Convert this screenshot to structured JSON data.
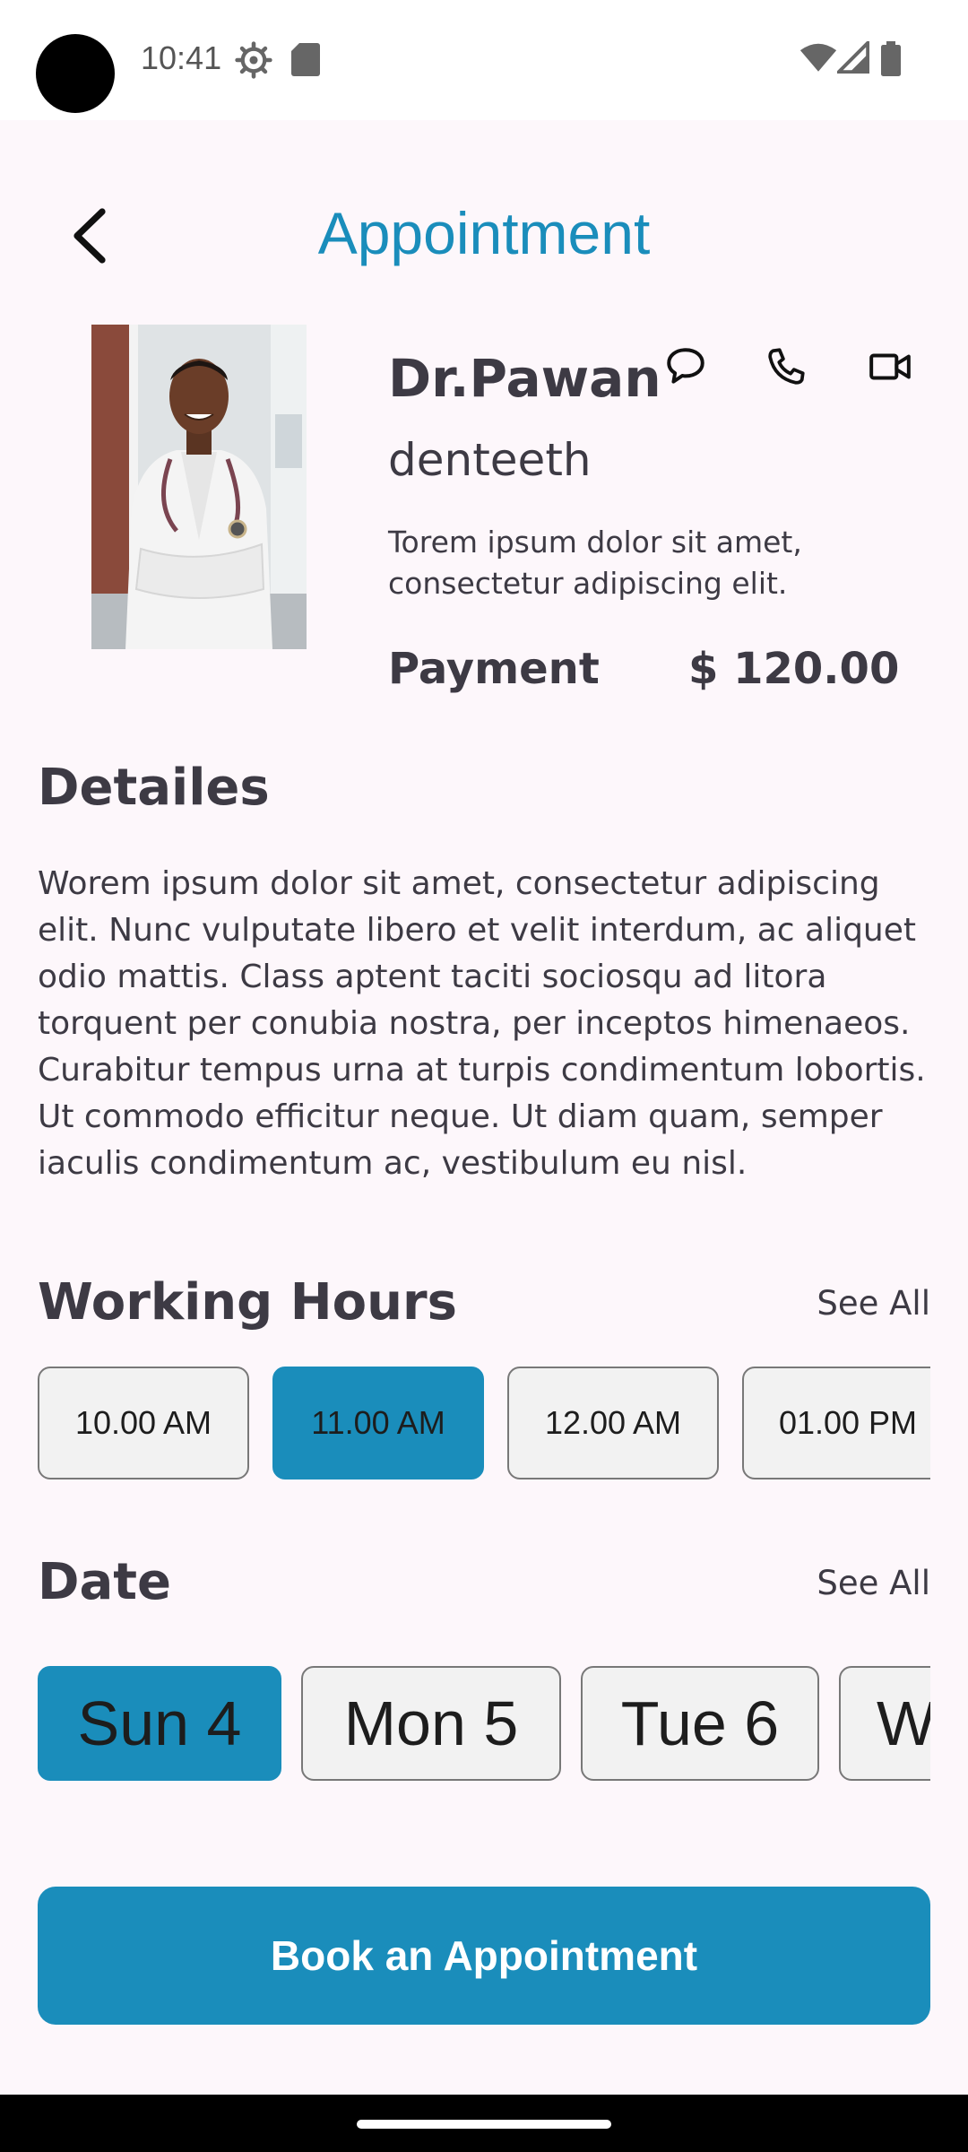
{
  "status_bar": {
    "time": "10:41"
  },
  "header": {
    "title": "Appointment"
  },
  "doctor": {
    "name": "Dr.Pawan",
    "specialty": "denteeth",
    "description": "Torem ipsum dolor sit amet, consectetur adipiscing elit.",
    "payment_label": "Payment",
    "payment_value": "$ 120.00"
  },
  "details": {
    "title": "Detailes",
    "text": "Worem ipsum dolor sit amet, consectetur adipiscing elit. Nunc vulputate libero et velit interdum, ac aliquet odio mattis. Class aptent taciti sociosqu ad litora torquent per conubia nostra, per inceptos himenaeos. Curabitur tempus urna at turpis condimentum lobortis. Ut commodo efficitur neque. Ut diam quam, semper iaculis condimentum ac, vestibulum eu nisl."
  },
  "working_hours": {
    "title": "Working Hours",
    "see_all": "See All",
    "slots": [
      "10.00 AM",
      "11.00 AM",
      "12.00 AM",
      "01.00 PM"
    ],
    "selected": "11.00 AM"
  },
  "date": {
    "title": "Date",
    "see_all": "See All",
    "days": [
      "Sun 4",
      "Mon 5",
      "Tue 6",
      "W"
    ],
    "selected": "Sun 4"
  },
  "book_button": "Book an Appointment",
  "colors": {
    "accent": "#1a8dbb",
    "background": "#fdf7fb",
    "text": "#3d3a44"
  }
}
